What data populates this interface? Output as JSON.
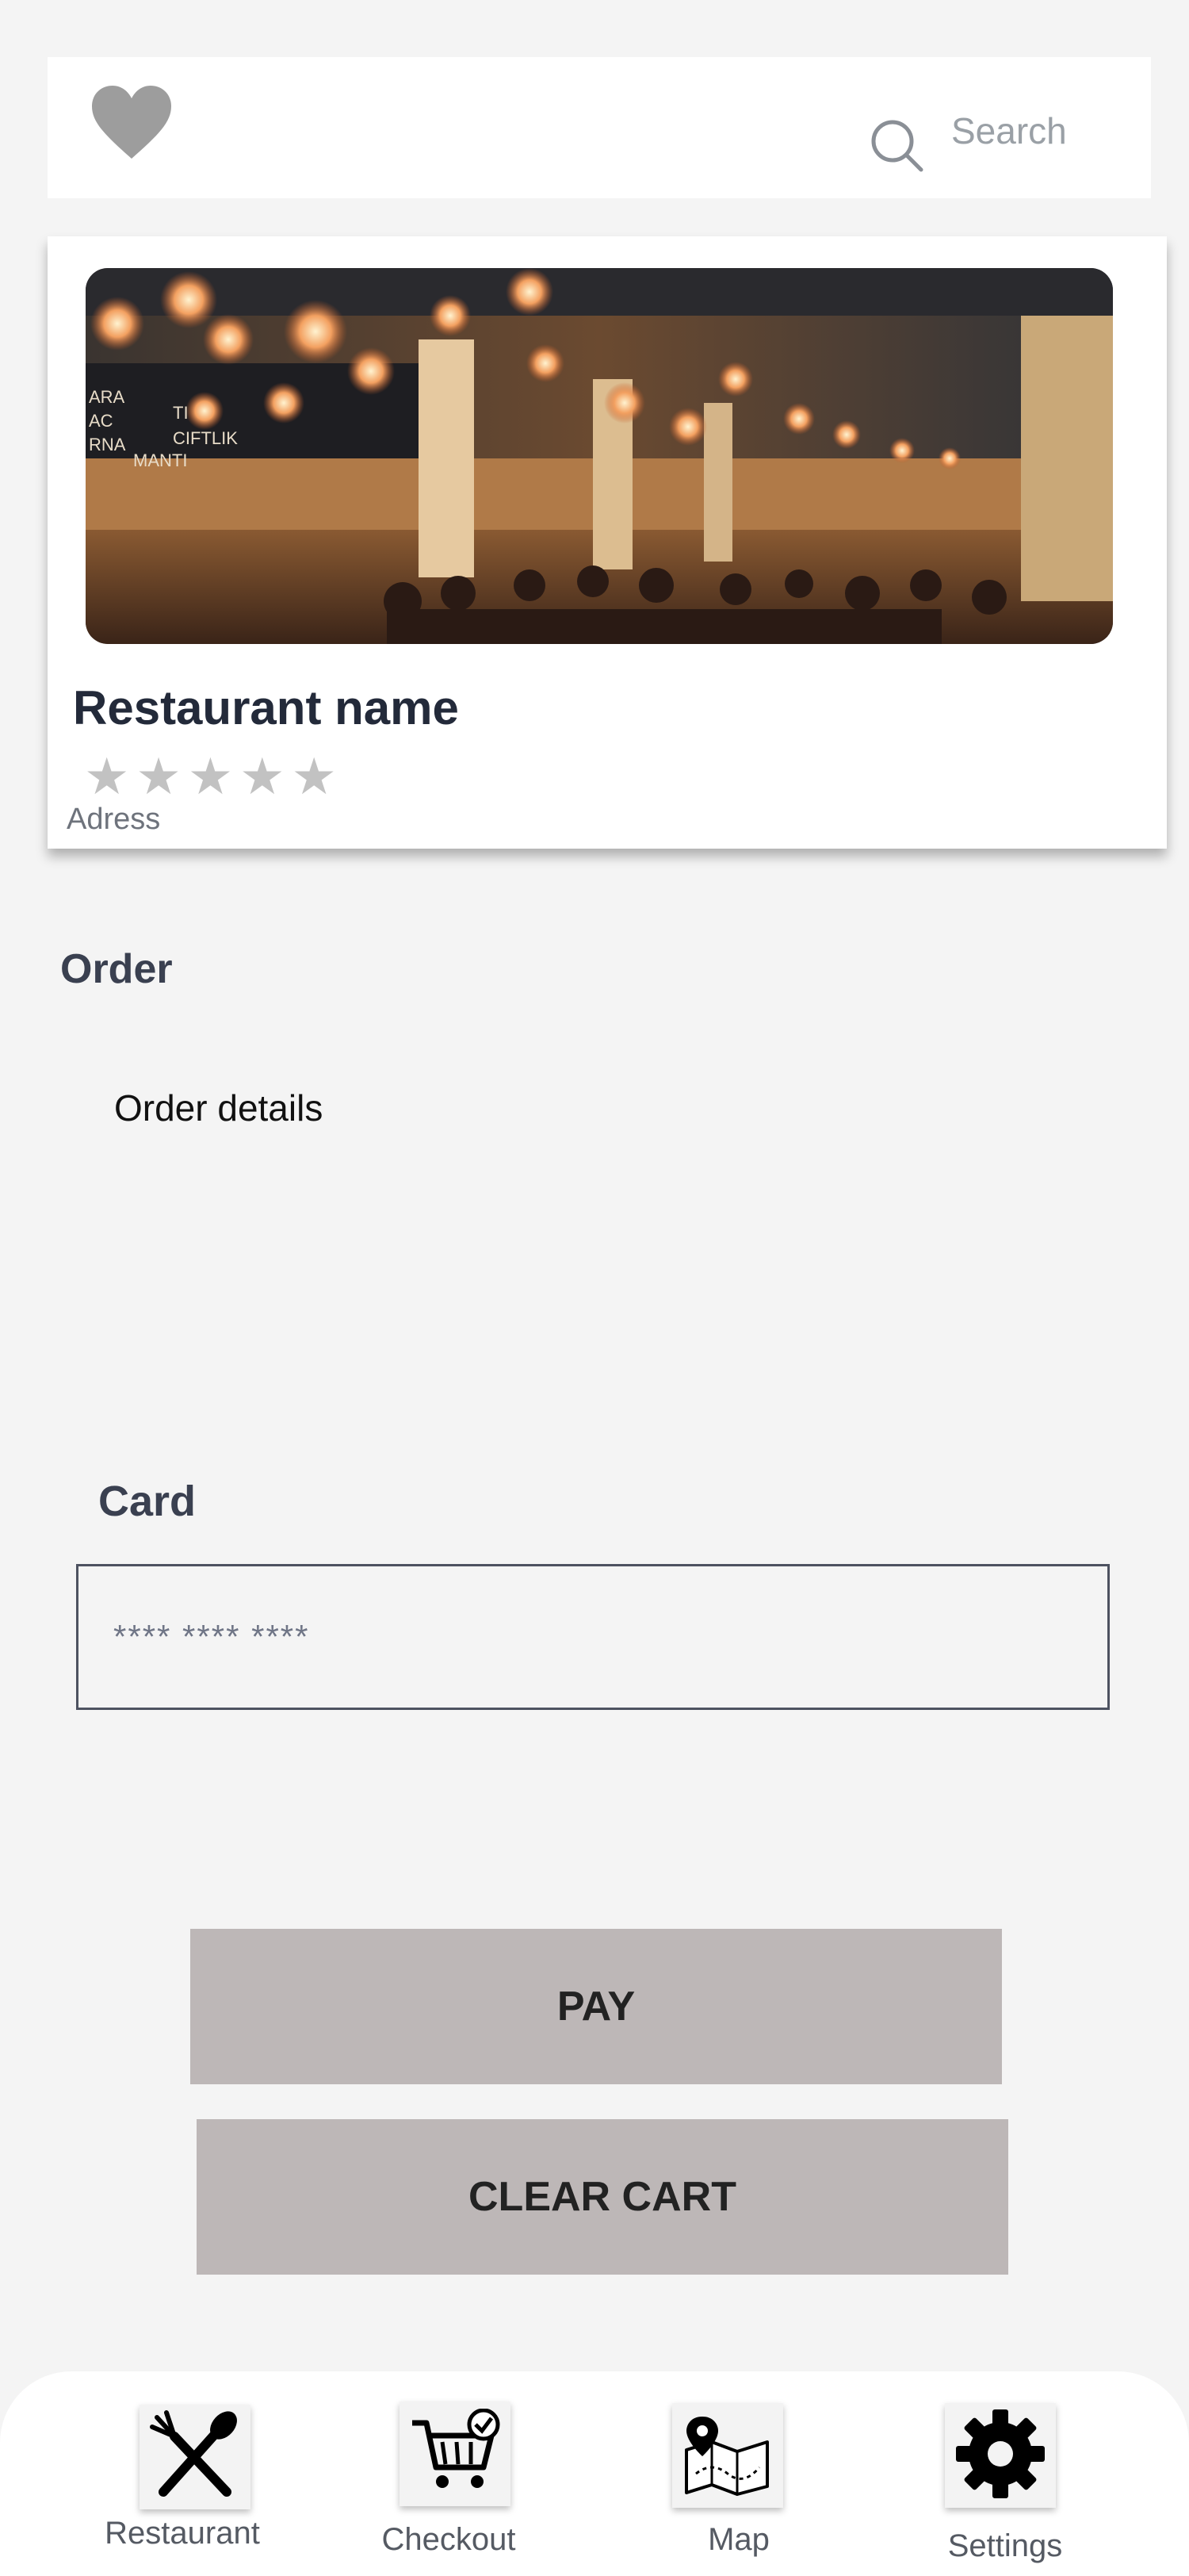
{
  "header": {
    "favorite_icon": "heart-icon",
    "search_icon": "search-icon",
    "search_placeholder": "Search"
  },
  "restaurant": {
    "photo": "restaurant-interior-photo",
    "name": "Restaurant name",
    "rating_stars": 5,
    "rating_filled": 0,
    "address": "Adress"
  },
  "order": {
    "heading": "Order",
    "details": "Order details"
  },
  "card": {
    "heading": "Card",
    "placeholder": "**** **** ****"
  },
  "actions": {
    "pay_label": "PAY",
    "clear_cart_label": "CLEAR CART"
  },
  "nav": {
    "items": [
      {
        "label": "Restaurant",
        "icon": "fork-knife-icon"
      },
      {
        "label": "Checkout",
        "icon": "cart-check-icon"
      },
      {
        "label": "Map",
        "icon": "map-pin-icon"
      },
      {
        "label": "Settings",
        "icon": "gear-icon"
      }
    ]
  },
  "colors": {
    "background": "#f4f4f4",
    "button": "#bdb7b7",
    "text_dark": "#232a3a"
  }
}
